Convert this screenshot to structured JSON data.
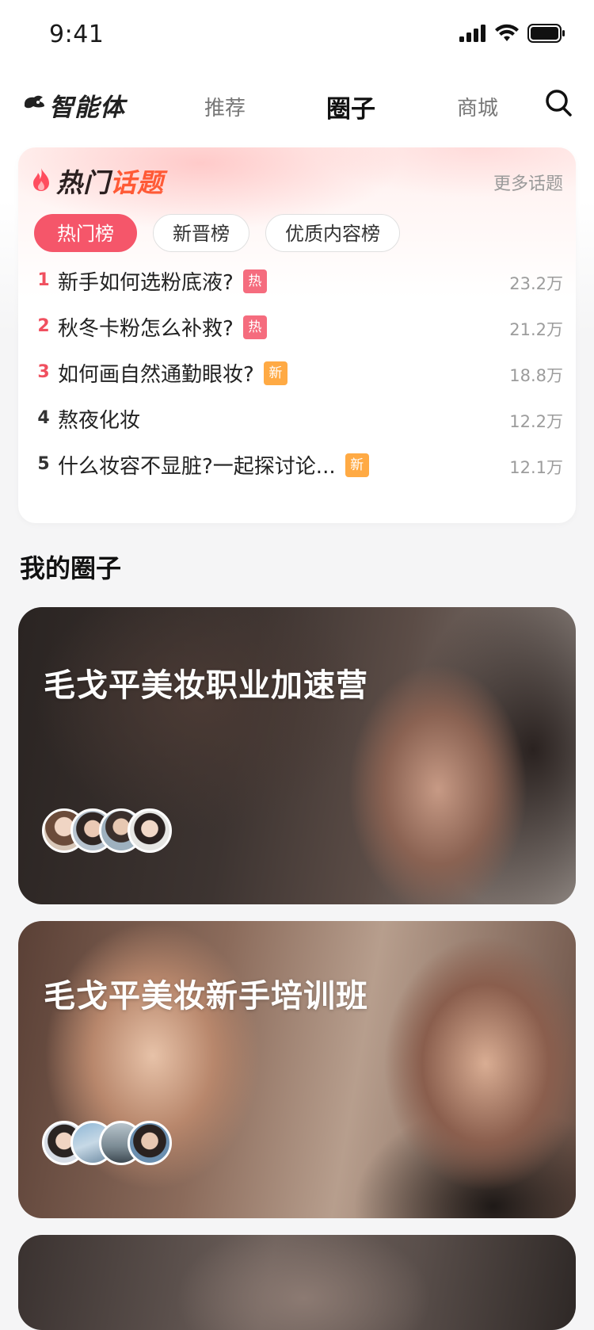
{
  "status_bar": {
    "time": "9:41"
  },
  "nav": {
    "logo_text": "智能体",
    "tabs": [
      {
        "label": "推荐",
        "active": false
      },
      {
        "label": "圈子",
        "active": true
      },
      {
        "label": "商城",
        "active": false
      }
    ]
  },
  "hot_topics": {
    "title_part1": "热门",
    "title_part2": "话题",
    "more_label": "更多话题",
    "chips": [
      {
        "label": "热门榜",
        "active": true
      },
      {
        "label": "新晋榜",
        "active": false
      },
      {
        "label": "优质内容榜",
        "active": false
      }
    ],
    "items": [
      {
        "rank": "1",
        "title": "新手如何选粉底液?",
        "badge": "热",
        "badge_type": "hot",
        "count": "23.2万"
      },
      {
        "rank": "2",
        "title": "秋冬卡粉怎么补救?",
        "badge": "热",
        "badge_type": "hot",
        "count": "21.2万"
      },
      {
        "rank": "3",
        "title": "如何画自然通勤眼妆?",
        "badge": "新",
        "badge_type": "new",
        "count": "18.8万"
      },
      {
        "rank": "4",
        "title": "熬夜化妆",
        "badge": "",
        "badge_type": "",
        "count": "12.2万"
      },
      {
        "rank": "5",
        "title": "什么妆容不显脏?一起探讨论...",
        "badge": "新",
        "badge_type": "new",
        "count": "12.1万"
      }
    ]
  },
  "my_circles": {
    "title": "我的圈子",
    "circles": [
      {
        "name": "毛戈平美妆职业加速营"
      },
      {
        "name": "毛戈平美妆新手培训班"
      }
    ]
  },
  "colors": {
    "accent_pink": "#f5566a",
    "hot_badge": "#f56c7e",
    "new_badge": "#ffaa44",
    "title_orange": "#ff5a36"
  }
}
